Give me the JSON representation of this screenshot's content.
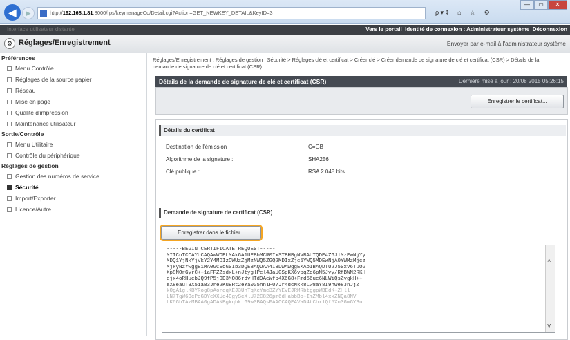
{
  "browser": {
    "back_glyph": "◀",
    "forward_glyph": "▶",
    "url_prefix": "http://",
    "url_host": "192.168.1.81",
    "url_rest": ":8000/rps/keymanageCo/Detail.cgi?Action=GET_NEWKEY_DETAIL&KeyID=3",
    "search_glyph": "ρ ▾ ¢",
    "home_glyph": "⌂",
    "star_glyph": "☆",
    "gear_glyph": "⚙",
    "window_min": "—",
    "window_max": "▭",
    "window_close": "✕"
  },
  "topbar": {
    "left_text": "Interface utilisateur distante",
    "portal_link": "Vers le portail",
    "login_info": "Identité de connexion : Administrateur système",
    "logout": "Déconnexion"
  },
  "header": {
    "title": "Réglages/Enregistrement",
    "email_link": "Envoyer par e-mail à l'administrateur système"
  },
  "sidebar": {
    "sections": [
      {
        "title": "Préférences",
        "items": [
          "Menu Contrôle",
          "Réglages de la source papier",
          "Réseau",
          "Mise en page",
          "Qualité d'impression",
          "Maintenance utilisateur"
        ]
      },
      {
        "title": "Sortie/Contrôle",
        "items": [
          "Menu Utilitaire",
          "Contrôle du périphérique"
        ]
      },
      {
        "title": "Réglages de gestion",
        "items": [
          "Gestion des numéros de service",
          "Sécurité",
          "Import/Exporter",
          "Licence/Autre"
        ]
      }
    ],
    "active": "Sécurité"
  },
  "main": {
    "breadcrumb": "Réglages/Enregistrement : Réglages de gestion : Sécurité > Réglages clé et certificat > Créer clé > Créer demande de signature de clé et certificat (CSR) > Détails de la demande de signature de clé et certificat (CSR)",
    "title": "Détails de la demande de signature de clé et certificat (CSR)",
    "last_update": "Dernière mise à jour : 20/08 2015 05:26:15",
    "register_button": "Enregistrer le certificat...",
    "cert_details_title": "Détails du certificat",
    "details": [
      {
        "label": "Destination de l'émission :",
        "value": "C=GB"
      },
      {
        "label": "Algorithme de la signature :",
        "value": "SHA256"
      },
      {
        "label": "Clé publique :",
        "value": "RSA 2 048 bits"
      }
    ],
    "csr_title": "Demande de signature de certificat (CSR)",
    "save_button": "Enregistrer dans le fichier...",
    "csr_lines": [
      "-----BEGIN CERTIFICATE REQUEST-----",
      "MIICnTCCAYUCAQAwWDELMAkGA1UEBhMCR0IxSTBHBgNVBAUTQDE4ZGJlMzEwNjYy",
      "MDQ1YjNkYjVkY2Y4MDIzOWUzZjMzNWQ5ZGQ2MDIxZjc5YWQ5MDEwNjA0YWMzMjcz",
      "MjkyNzYwggEiMA0GCSqGSIb3DQEBAQUAA4IBDwAwggEKAoIBAQDTU2J5SxV6TuOG",
      "Xp8NOrGyrC++1aFFZZsdxL+nJtyglPel4JaUGSpKX6vpqZq6pM5Jvy/RfBWN2RKH",
      "ejx4oRHuebJQ9fP5jDD3MO86rdvHTd9AeWfp4X6G8+Fmd56ue6NLWiQsZvgkH++",
      "eX8eauT3X51aB3Jre2KuERt2eYa0G5hnlF07Jr4dcNkk8Lw8aY8I9hwe8JnJjZ",
      "kOgA1glKBYRog8pAoreqKEJ3UhTqKeYmc3ZYYEvEJRMRbtggpWBEdK+ZHll",
      "LN7TgW6OcPcGDYeXXUe4DgyScXlU72C826pm6dHabbBo+ImZMbl4xxZNQa8NV",
      "LK6GhTAzMBAAGgADANBgkqhkiG9w0BAQsFAAOCAQEAVaD4tChxlQf5Xn3GmGY3u"
    ]
  }
}
